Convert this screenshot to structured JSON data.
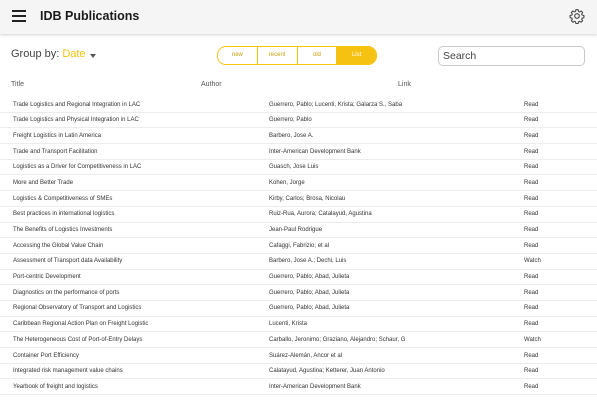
{
  "header": {
    "title": "IDB Publications",
    "menu_icon": "menu-icon",
    "settings_icon": "gear-icon"
  },
  "controls": {
    "group_by_label": "Group by:",
    "group_by_value": "Date",
    "toggles": [
      {
        "label": "new",
        "active": false
      },
      {
        "label": "recent",
        "active": false
      },
      {
        "label": "old",
        "active": false
      },
      {
        "label": "List",
        "active": true
      }
    ],
    "search": {
      "placeholder": "Search",
      "value": ""
    }
  },
  "table": {
    "columns": [
      "Title",
      "Author",
      "Link"
    ],
    "rows": [
      {
        "title": "Trade Logistics and Regional Integration in LAC",
        "author": "Guerrero, Pablo; Lucenti, Krista; Galarza S., Saba",
        "link": "Read"
      },
      {
        "title": "Trade Logistics and Physical Integration in LAC",
        "author": "Guerrero, Pablo",
        "link": "Read"
      },
      {
        "title": "Freight Logistics in Latin America",
        "author": "Barbero, Jose A.",
        "link": "Read"
      },
      {
        "title": "Trade and Transport Facilitation",
        "author": "Inter-American Development Bank",
        "link": "Read"
      },
      {
        "title": "Logistics as a Driver for Competitiveness in LAC",
        "author": "Guasch, Jose Luis",
        "link": "Read"
      },
      {
        "title": "More and Better Trade",
        "author": "Kohen, Jorge",
        "link": "Read"
      },
      {
        "title": "Logistics & Competitiveness of SMEs",
        "author": "Kirby, Carlos; Brosa, Nicolau",
        "link": "Read"
      },
      {
        "title": "Best practices in international logistics",
        "author": "Ruiz-Rua, Aurora; Catalayud, Agustina",
        "link": "Read"
      },
      {
        "title": "The Benefits of Logistics Investments",
        "author": "Jean-Paul Rodrigue",
        "link": "Read"
      },
      {
        "title": "Accessing the Global Value Chain",
        "author": "Cafaggi, Fabrizio; et al",
        "link": "Read"
      },
      {
        "title": "Assessment of Transport data Availability",
        "author": "Barbero, Jose A.; Dechi, Luis",
        "link": "Watch"
      },
      {
        "title": "Port-centric Development",
        "author": "Guerrero, Pablo; Abad, Julieta",
        "link": "Read"
      },
      {
        "title": "Diagnostics on the performance of ports",
        "author": "Guerrero, Pablo; Abad, Julieta",
        "link": "Read"
      },
      {
        "title": "Regional Observatory of Transport and Logistics",
        "author": "Guerrero, Pablo; Abad, Julieta",
        "link": "Read"
      },
      {
        "title": "Caribbean Regional Action Plan on Freight Logistic",
        "author": "Lucenti, Krista",
        "link": "Read"
      },
      {
        "title": "The Heterogeneous Cost of Port-of-Entry Delays",
        "author": "Carballo, Jeronimo; Graziano, Alejandro; Schaur, G",
        "link": "Watch"
      },
      {
        "title": "Container Port Efficiency",
        "author": "Suárez-Alemán, Ancor et al",
        "link": "Read"
      },
      {
        "title": "Integrated risk management value chains",
        "author": "Calatayud, Agustina; Ketterer, Juan Antonio",
        "link": "Read"
      },
      {
        "title": "Yearbook of freight and logistics",
        "author": "Inter-American Development Bank",
        "link": "Read"
      }
    ]
  }
}
